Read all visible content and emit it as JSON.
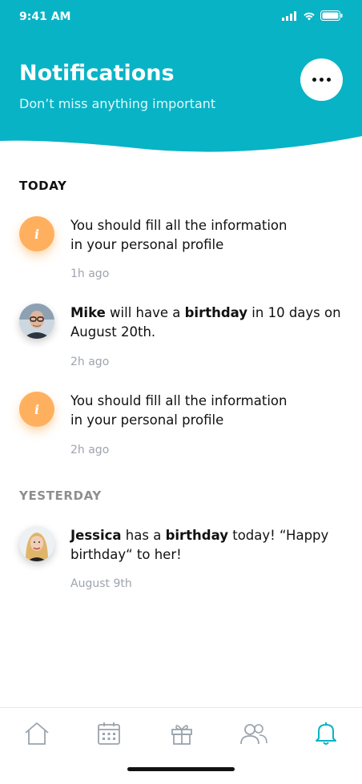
{
  "status": {
    "time": "9:41 AM"
  },
  "header": {
    "title": "Notifications",
    "subtitle": "Don’t miss anything important"
  },
  "sections": {
    "today": "TODAY",
    "yesterday": "YESTERDAY"
  },
  "notifications": [
    {
      "type": "info",
      "line1": "You should fill all the information",
      "line2": "in your personal profile",
      "time": "1h ago"
    },
    {
      "type": "person",
      "name": "Mike",
      "part1": " will have a ",
      "bold": "birthday",
      "part2": " in 10 days on",
      "line2": "August 20th.",
      "time": "2h ago"
    },
    {
      "type": "info",
      "line1": "You should fill all the information",
      "line2": "in your personal profile",
      "time": "2h ago"
    },
    {
      "type": "person",
      "name": "Jessica",
      "part1": " has a ",
      "bold": "birthday",
      "part2": " today! “Happy",
      "line2": "birthday“ to her!",
      "time": "August 9th"
    }
  ],
  "info_glyph": "i",
  "tabs": [
    "home-icon",
    "calendar-icon",
    "gift-icon",
    "people-icon",
    "bell-icon"
  ],
  "colors": {
    "accent": "#08b3c6",
    "info": "#ffb05f",
    "inactive_tab": "#9aa3ad"
  }
}
